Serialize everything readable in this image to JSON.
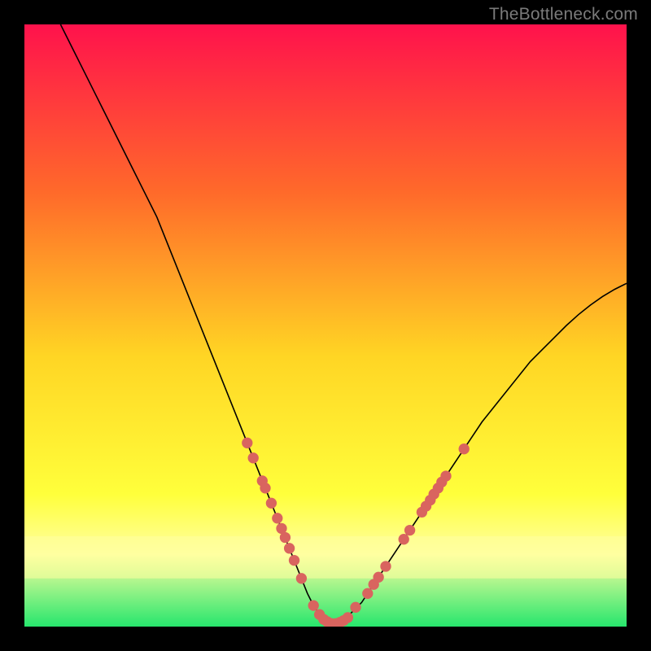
{
  "watermark": "TheBottleneck.com",
  "colors": {
    "bg": "#000000",
    "grad_top": "#ff124c",
    "grad_mid1": "#ff6a2a",
    "grad_mid2": "#ffd524",
    "grad_mid3": "#ffff3b",
    "grad_band": "#ffffa0",
    "grad_bottom": "#27e66d",
    "curve": "#000000",
    "marker": "#d9645f"
  },
  "chart_data": {
    "type": "line",
    "title": "",
    "xlabel": "",
    "ylabel": "",
    "xlim": [
      0,
      100
    ],
    "ylim": [
      0,
      100
    ],
    "series": [
      {
        "name": "curve",
        "x": [
          6,
          8,
          10,
          12,
          14,
          16,
          18,
          20,
          22,
          24,
          26,
          28,
          30,
          32,
          34,
          36,
          38,
          40,
          42,
          44,
          46,
          47,
          48,
          49,
          50,
          51,
          52,
          53,
          54,
          56,
          58,
          60,
          62,
          64,
          66,
          68,
          70,
          72,
          74,
          76,
          78,
          80,
          82,
          84,
          86,
          88,
          90,
          92,
          94,
          96,
          98,
          100
        ],
        "y": [
          100,
          96,
          92,
          88,
          84,
          80,
          76,
          72,
          68,
          63,
          58,
          53,
          48,
          43,
          38,
          33,
          28,
          23,
          18,
          13,
          8,
          5.5,
          3.5,
          2,
          1,
          0.5,
          0.5,
          1,
          2,
          4,
          7,
          10,
          13,
          16,
          19,
          22,
          25,
          28,
          31,
          34,
          36.5,
          39,
          41.5,
          44,
          46,
          48,
          50,
          51.8,
          53.4,
          54.8,
          56,
          57
        ]
      }
    ],
    "markers": [
      {
        "x": 37,
        "y": 30.5
      },
      {
        "x": 38,
        "y": 28
      },
      {
        "x": 39.5,
        "y": 24.2
      },
      {
        "x": 40,
        "y": 23
      },
      {
        "x": 41,
        "y": 20.5
      },
      {
        "x": 42,
        "y": 18
      },
      {
        "x": 42.7,
        "y": 16.3
      },
      {
        "x": 43.3,
        "y": 14.8
      },
      {
        "x": 44,
        "y": 13
      },
      {
        "x": 44.8,
        "y": 11
      },
      {
        "x": 46,
        "y": 8
      },
      {
        "x": 48,
        "y": 3.5
      },
      {
        "x": 49,
        "y": 2
      },
      {
        "x": 49.7,
        "y": 1.2
      },
      {
        "x": 50.3,
        "y": 0.8
      },
      {
        "x": 51,
        "y": 0.5
      },
      {
        "x": 51.7,
        "y": 0.5
      },
      {
        "x": 52.4,
        "y": 0.7
      },
      {
        "x": 53,
        "y": 1
      },
      {
        "x": 53.7,
        "y": 1.5
      },
      {
        "x": 55,
        "y": 3.2
      },
      {
        "x": 57,
        "y": 5.5
      },
      {
        "x": 58,
        "y": 7
      },
      {
        "x": 58.8,
        "y": 8.2
      },
      {
        "x": 60,
        "y": 10
      },
      {
        "x": 63,
        "y": 14.5
      },
      {
        "x": 64,
        "y": 16
      },
      {
        "x": 66,
        "y": 19
      },
      {
        "x": 66.7,
        "y": 20
      },
      {
        "x": 67.4,
        "y": 21
      },
      {
        "x": 68,
        "y": 22
      },
      {
        "x": 68.7,
        "y": 23
      },
      {
        "x": 69.3,
        "y": 24
      },
      {
        "x": 70,
        "y": 25
      },
      {
        "x": 73,
        "y": 29.5
      }
    ]
  }
}
